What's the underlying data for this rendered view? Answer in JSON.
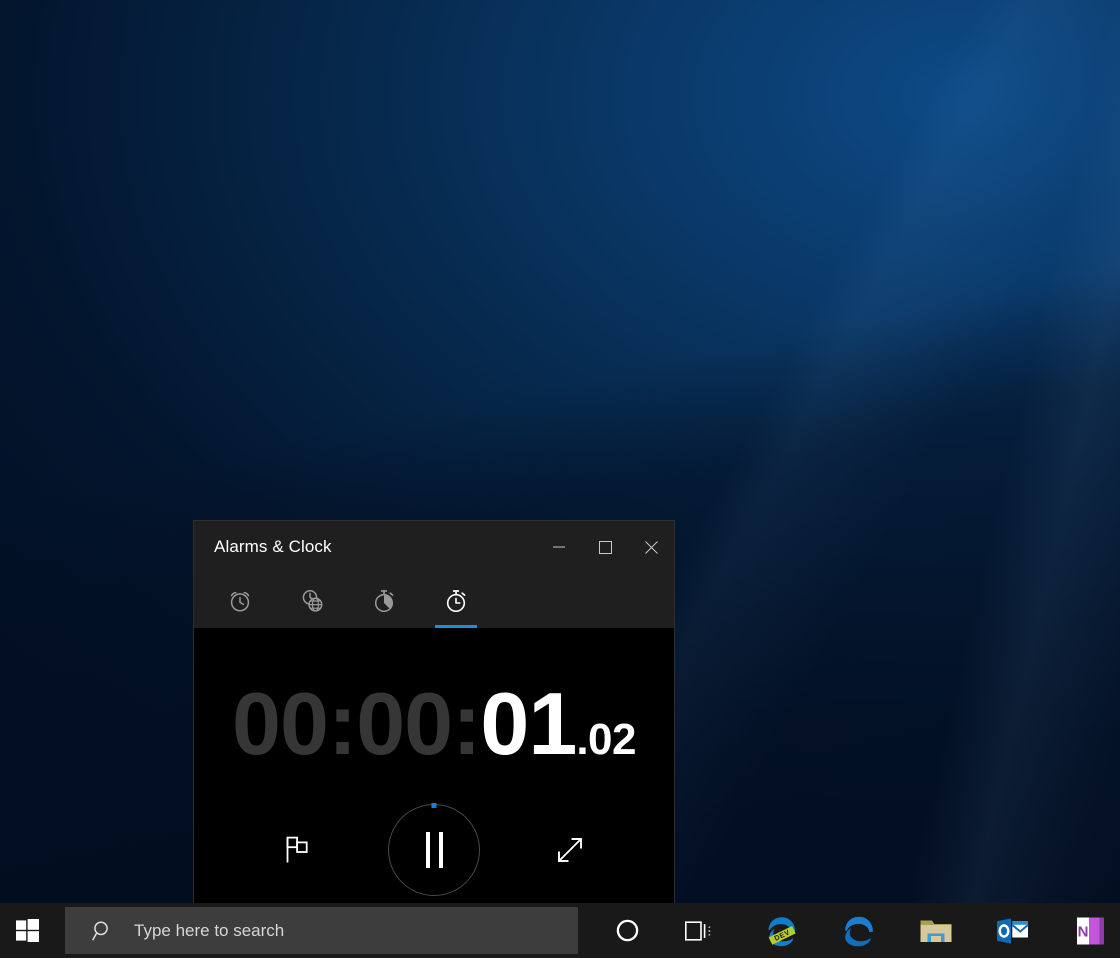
{
  "window": {
    "title": "Alarms & Clock",
    "controls": {
      "minimize": {
        "label": "Minimize",
        "icon": "minimize-icon"
      },
      "maximize": {
        "label": "Maximize",
        "icon": "maximize-icon"
      },
      "close": {
        "label": "Close",
        "icon": "close-icon"
      }
    }
  },
  "tabs": [
    {
      "label": "Alarm",
      "icon": "alarm-clock-icon",
      "selected": false
    },
    {
      "label": "World Clock",
      "icon": "world-clock-icon",
      "selected": false
    },
    {
      "label": "Timer",
      "icon": "timer-icon",
      "selected": false
    },
    {
      "label": "Stopwatch",
      "icon": "stopwatch-icon",
      "selected": true
    }
  ],
  "stopwatch": {
    "elapsed": "00:00:01.02",
    "hours": "00",
    "sep1": ":",
    "minutes": "00",
    "sep2": ":",
    "seconds": "01",
    "fraction": ".02",
    "running": true,
    "controls": {
      "lap": {
        "label": "Lap",
        "icon": "flag-icon"
      },
      "pause": {
        "label": "Pause",
        "icon": "pause-icon"
      },
      "expand": {
        "label": "Expand",
        "icon": "expand-diagonal-icon"
      }
    }
  },
  "taskbar": {
    "start": {
      "label": "Start",
      "icon": "windows-logo-icon"
    },
    "search": {
      "placeholder": "Type here to search",
      "value": "",
      "icon": "search-icon"
    },
    "items": [
      {
        "label": "Cortana",
        "icon": "cortana-circle-icon"
      },
      {
        "label": "Task View",
        "icon": "task-view-icon"
      },
      {
        "label": "Microsoft Edge Dev",
        "icon": "edge-dev-icon"
      },
      {
        "label": "Microsoft Edge",
        "icon": "edge-icon"
      },
      {
        "label": "File Explorer",
        "icon": "folder-icon"
      },
      {
        "label": "Outlook",
        "icon": "outlook-icon"
      },
      {
        "label": "OneNote",
        "icon": "onenote-icon"
      }
    ]
  },
  "colors": {
    "accent": "#0f83d6",
    "tab_underline": "#1a8fe0",
    "title_bar": "#1f1f1f",
    "app_background": "#000000",
    "taskbar": "#191919",
    "search_box": "#3d3d3d",
    "dim_digits": "#363636",
    "bright_digits": "#ffffff"
  }
}
